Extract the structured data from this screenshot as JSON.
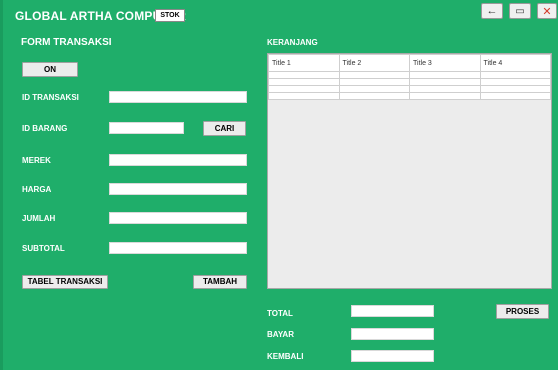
{
  "window": {
    "title": "GLOBAL ARTHA COMPUTER",
    "stok_button": "STOK",
    "controls": [
      {
        "name": "back-icon",
        "glyph": "←"
      },
      {
        "name": "minimize-icon",
        "glyph": "▭"
      },
      {
        "name": "close-icon",
        "glyph": "✕"
      }
    ]
  },
  "form": {
    "title": "FORM TRANSAKSI",
    "on_button": "ON",
    "labels": {
      "id_transaksi": "ID TRANSAKSI",
      "id_barang": "ID BARANG",
      "merek": "MEREK",
      "harga": "HARGA",
      "jumlah": "JUMLAH",
      "subtotal": "SUBTOTAL"
    },
    "values": {
      "id_transaksi": "",
      "id_barang": "",
      "merek": "",
      "harga": "",
      "jumlah": "",
      "subtotal": ""
    },
    "cari_button": "CARI",
    "tabel_button": "TABEL TRANSAKSI",
    "tambah_button": "TAMBAH"
  },
  "cart": {
    "title": "KERANJANG",
    "columns": [
      "Title 1",
      "Title 2",
      "Title 3",
      "Title 4"
    ],
    "rows": [
      [
        "",
        "",
        "",
        ""
      ],
      [
        "",
        "",
        "",
        ""
      ],
      [
        "",
        "",
        "",
        ""
      ],
      [
        "",
        "",
        "",
        ""
      ]
    ]
  },
  "summary": {
    "total_label": "TOTAL",
    "bayar_label": "BAYAR",
    "kembali_label": "KEMBALI",
    "total_value": "",
    "bayar_value": "",
    "kembali_value": "",
    "proses_button": "PROSES"
  },
  "colors": {
    "background": "#1fae6a",
    "close_icon": "#d23a2a"
  }
}
